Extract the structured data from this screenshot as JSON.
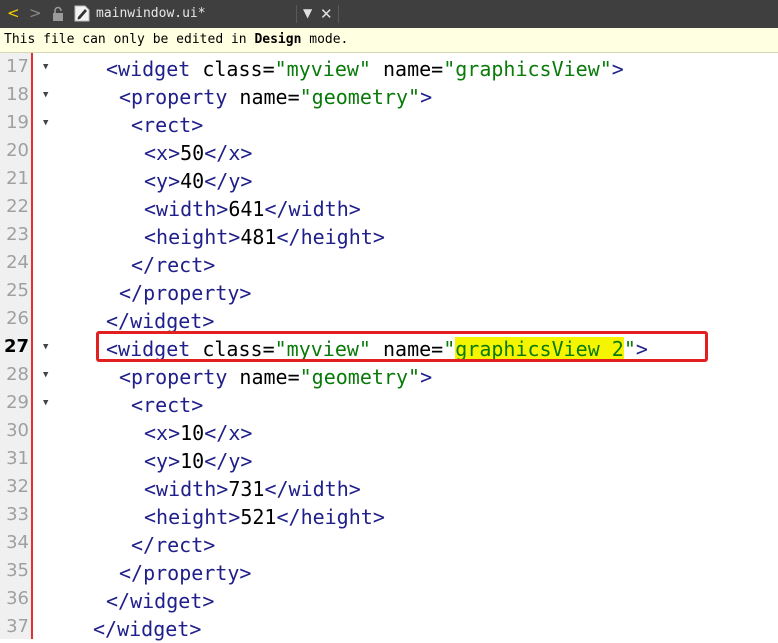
{
  "tab": {
    "nav_back": "<",
    "nav_forward": ">",
    "lock_icon": "lock-icon",
    "file_icon": "file-icon",
    "filename": "mainwindow.ui*",
    "dropdown": "▼",
    "close": "✕"
  },
  "infobar": {
    "prefix": "This file can only be edited in ",
    "bold": "Design",
    "suffix": " mode."
  },
  "editor": {
    "current_line": "27",
    "lines": [
      {
        "num": "17",
        "fold": "▼"
      },
      {
        "num": "18",
        "fold": "▼"
      },
      {
        "num": "19",
        "fold": "▼"
      },
      {
        "num": "20",
        "fold": ""
      },
      {
        "num": "21",
        "fold": ""
      },
      {
        "num": "22",
        "fold": ""
      },
      {
        "num": "23",
        "fold": ""
      },
      {
        "num": "24",
        "fold": ""
      },
      {
        "num": "25",
        "fold": ""
      },
      {
        "num": "26",
        "fold": ""
      },
      {
        "num": "27",
        "fold": "▼"
      },
      {
        "num": "28",
        "fold": "▼"
      },
      {
        "num": "29",
        "fold": "▼"
      },
      {
        "num": "30",
        "fold": ""
      },
      {
        "num": "31",
        "fold": ""
      },
      {
        "num": "32",
        "fold": ""
      },
      {
        "num": "33",
        "fold": ""
      },
      {
        "num": "34",
        "fold": ""
      },
      {
        "num": "35",
        "fold": ""
      },
      {
        "num": "36",
        "fold": ""
      },
      {
        "num": "37",
        "fold": ""
      }
    ],
    "code": {
      "l17_tag": "widget",
      "l17_attr1": "class",
      "l17_val1": "\"myview\"",
      "l17_attr2": "name",
      "l17_val2": "\"graphicsView\"",
      "l18_tag": "property",
      "l18_attr": "name",
      "l18_val": "\"geometry\"",
      "l19_tag": "rect",
      "l20_tag": "x",
      "l20_val": "50",
      "l21_tag": "y",
      "l21_val": "40",
      "l22_tag": "width",
      "l22_val": "641",
      "l23_tag": "height",
      "l23_val": "481",
      "l24_tag": "rect",
      "l25_tag": "property",
      "l26_tag": "widget",
      "l27_tag": "widget",
      "l27_attr1": "class",
      "l27_val1": "\"myview\"",
      "l27_attr2": "name",
      "l27_quote_open": "\"",
      "l27_hl": "graphicsView_2",
      "l27_quote_close": "\"",
      "l28_tag": "property",
      "l28_attr": "name",
      "l28_val": "\"geometry\"",
      "l29_tag": "rect",
      "l30_tag": "x",
      "l30_val": "10",
      "l31_tag": "y",
      "l31_val": "10",
      "l32_tag": "width",
      "l32_val": "731",
      "l33_tag": "height",
      "l33_val": "521",
      "l34_tag": "rect",
      "l35_tag": "property",
      "l36_tag": "widget",
      "l37_tag": "widget"
    }
  },
  "colors": {
    "tag": "#20208a",
    "string": "#0a7a0a",
    "highlight": "#f5f500",
    "annotation_box": "#e32020"
  }
}
